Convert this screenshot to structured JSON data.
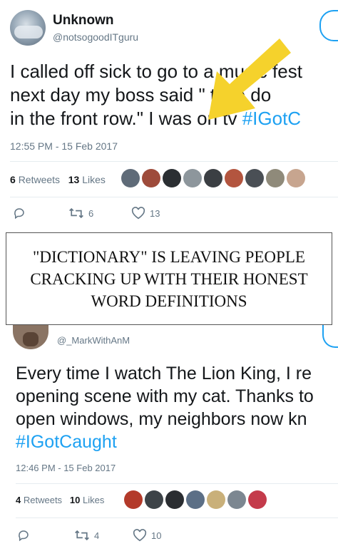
{
  "tweet1": {
    "name": "Unknown",
    "handle": "@notsogoodITguru",
    "text_lines": [
      "I called off sick to go to a music fest",
      "next day my boss said \" time do",
      "in the front row.\" I was on tv "
    ],
    "hashtag": "#IGotC",
    "timestamp": "12:55 PM - 15 Feb 2017",
    "retweets_count": "6",
    "retweets_label": "Retweets",
    "likes_count": "13",
    "likes_label": "Likes",
    "reply_count": "",
    "retweet_action_count": "6",
    "like_action_count": "13",
    "liker_avatar_colors": [
      "#5f6b78",
      "#9e4b3b",
      "#2b2f33",
      "#8d969c",
      "#3b3f43",
      "#b3553f",
      "#4a4f55",
      "#8f8a7a",
      "#c7a58f"
    ]
  },
  "caption": {
    "text": "\"DICTIONARY\" IS LEAVING PEOPLE CRACKING UP WITH THEIR HONEST WORD DEFINITIONS"
  },
  "tweet2": {
    "handle": "@_MarkWithAnM",
    "text_lines": [
      "Every time I watch The Lion King, I re",
      "opening scene with my cat. Thanks to",
      "open windows, my neighbors now kn"
    ],
    "hashtag": "#IGotCaught",
    "timestamp": "12:46 PM - 15 Feb 2017",
    "retweets_count": "4",
    "retweets_label": "Retweets",
    "likes_count": "10",
    "likes_label": "Likes",
    "retweet_action_count": "4",
    "like_action_count": "10",
    "liker_avatar_colors": [
      "#b33a2a",
      "#3d4348",
      "#2a2d31",
      "#5c6f86",
      "#c9b07a",
      "#7c8791",
      "#c43b4b"
    ]
  },
  "colors": {
    "link_blue": "#1da1f2",
    "muted_gray": "#657786",
    "arrow_yellow": "#f5d22c"
  }
}
